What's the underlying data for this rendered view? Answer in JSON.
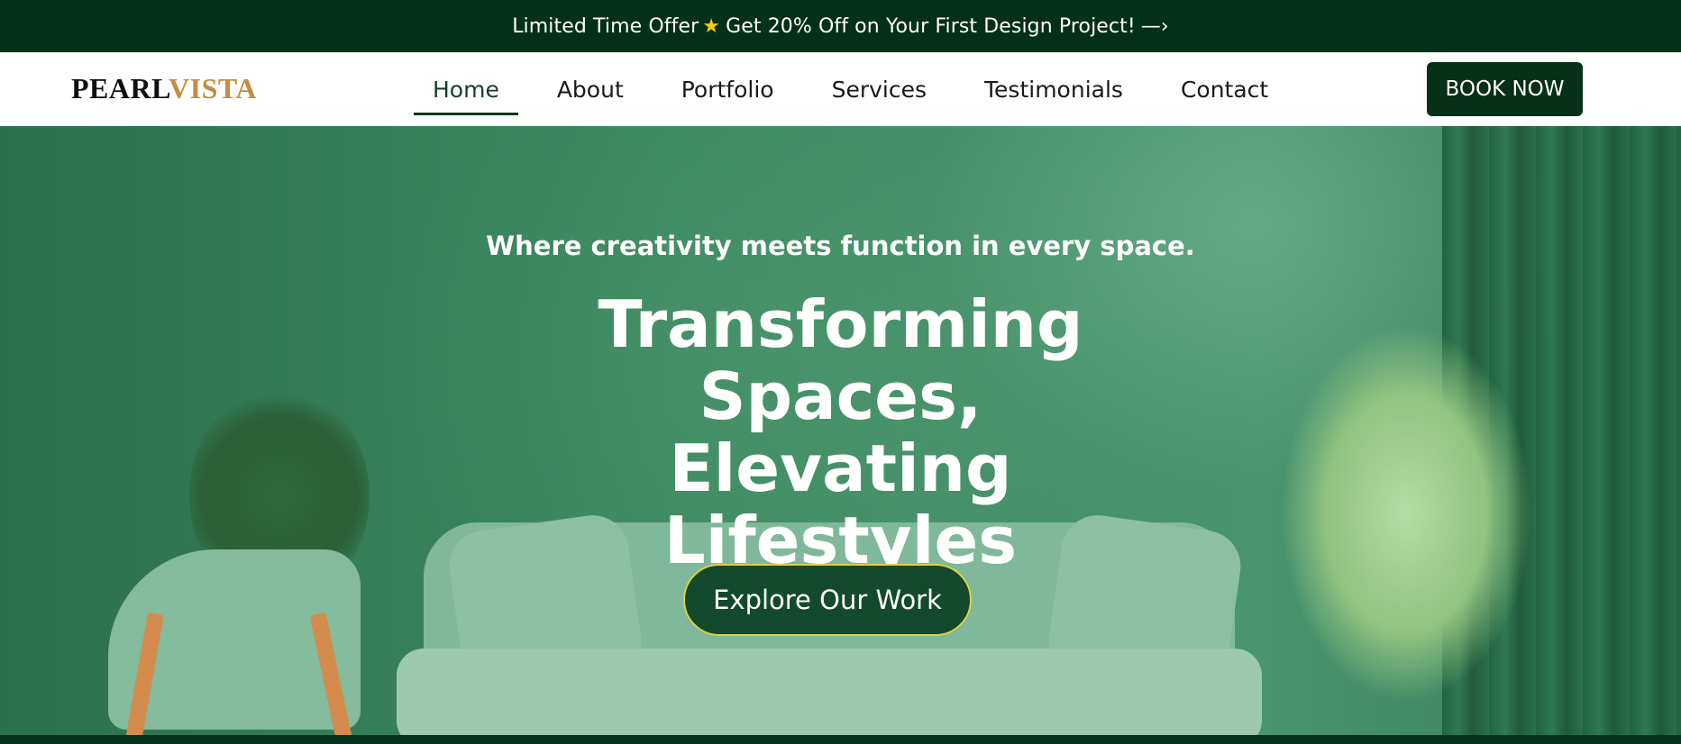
{
  "promo": {
    "text_before": "Limited Time Offer",
    "star_glyph": "★",
    "text_after": "Get 20% Off on Your First Design Project!",
    "arrow_glyph": "—›"
  },
  "header": {
    "logo_part1": "PEARL",
    "logo_part2": "VISTA",
    "nav_items": [
      {
        "label": "Home",
        "active": true
      },
      {
        "label": "About",
        "active": false
      },
      {
        "label": "Portfolio",
        "active": false
      },
      {
        "label": "Services",
        "active": false
      },
      {
        "label": "Testimonials",
        "active": false
      },
      {
        "label": "Contact",
        "active": false
      }
    ],
    "book_label": "BOOK NOW"
  },
  "hero": {
    "tagline": "Where creativity meets function in every space.",
    "headline": "Transforming Spaces, Elevating Lifestyles",
    "cta_label": "Explore Our Work"
  },
  "colors": {
    "dark_green": "#033018",
    "logo_gold": "#c48d3f",
    "cta_border": "#e0cf46",
    "star": "#f6c915"
  }
}
